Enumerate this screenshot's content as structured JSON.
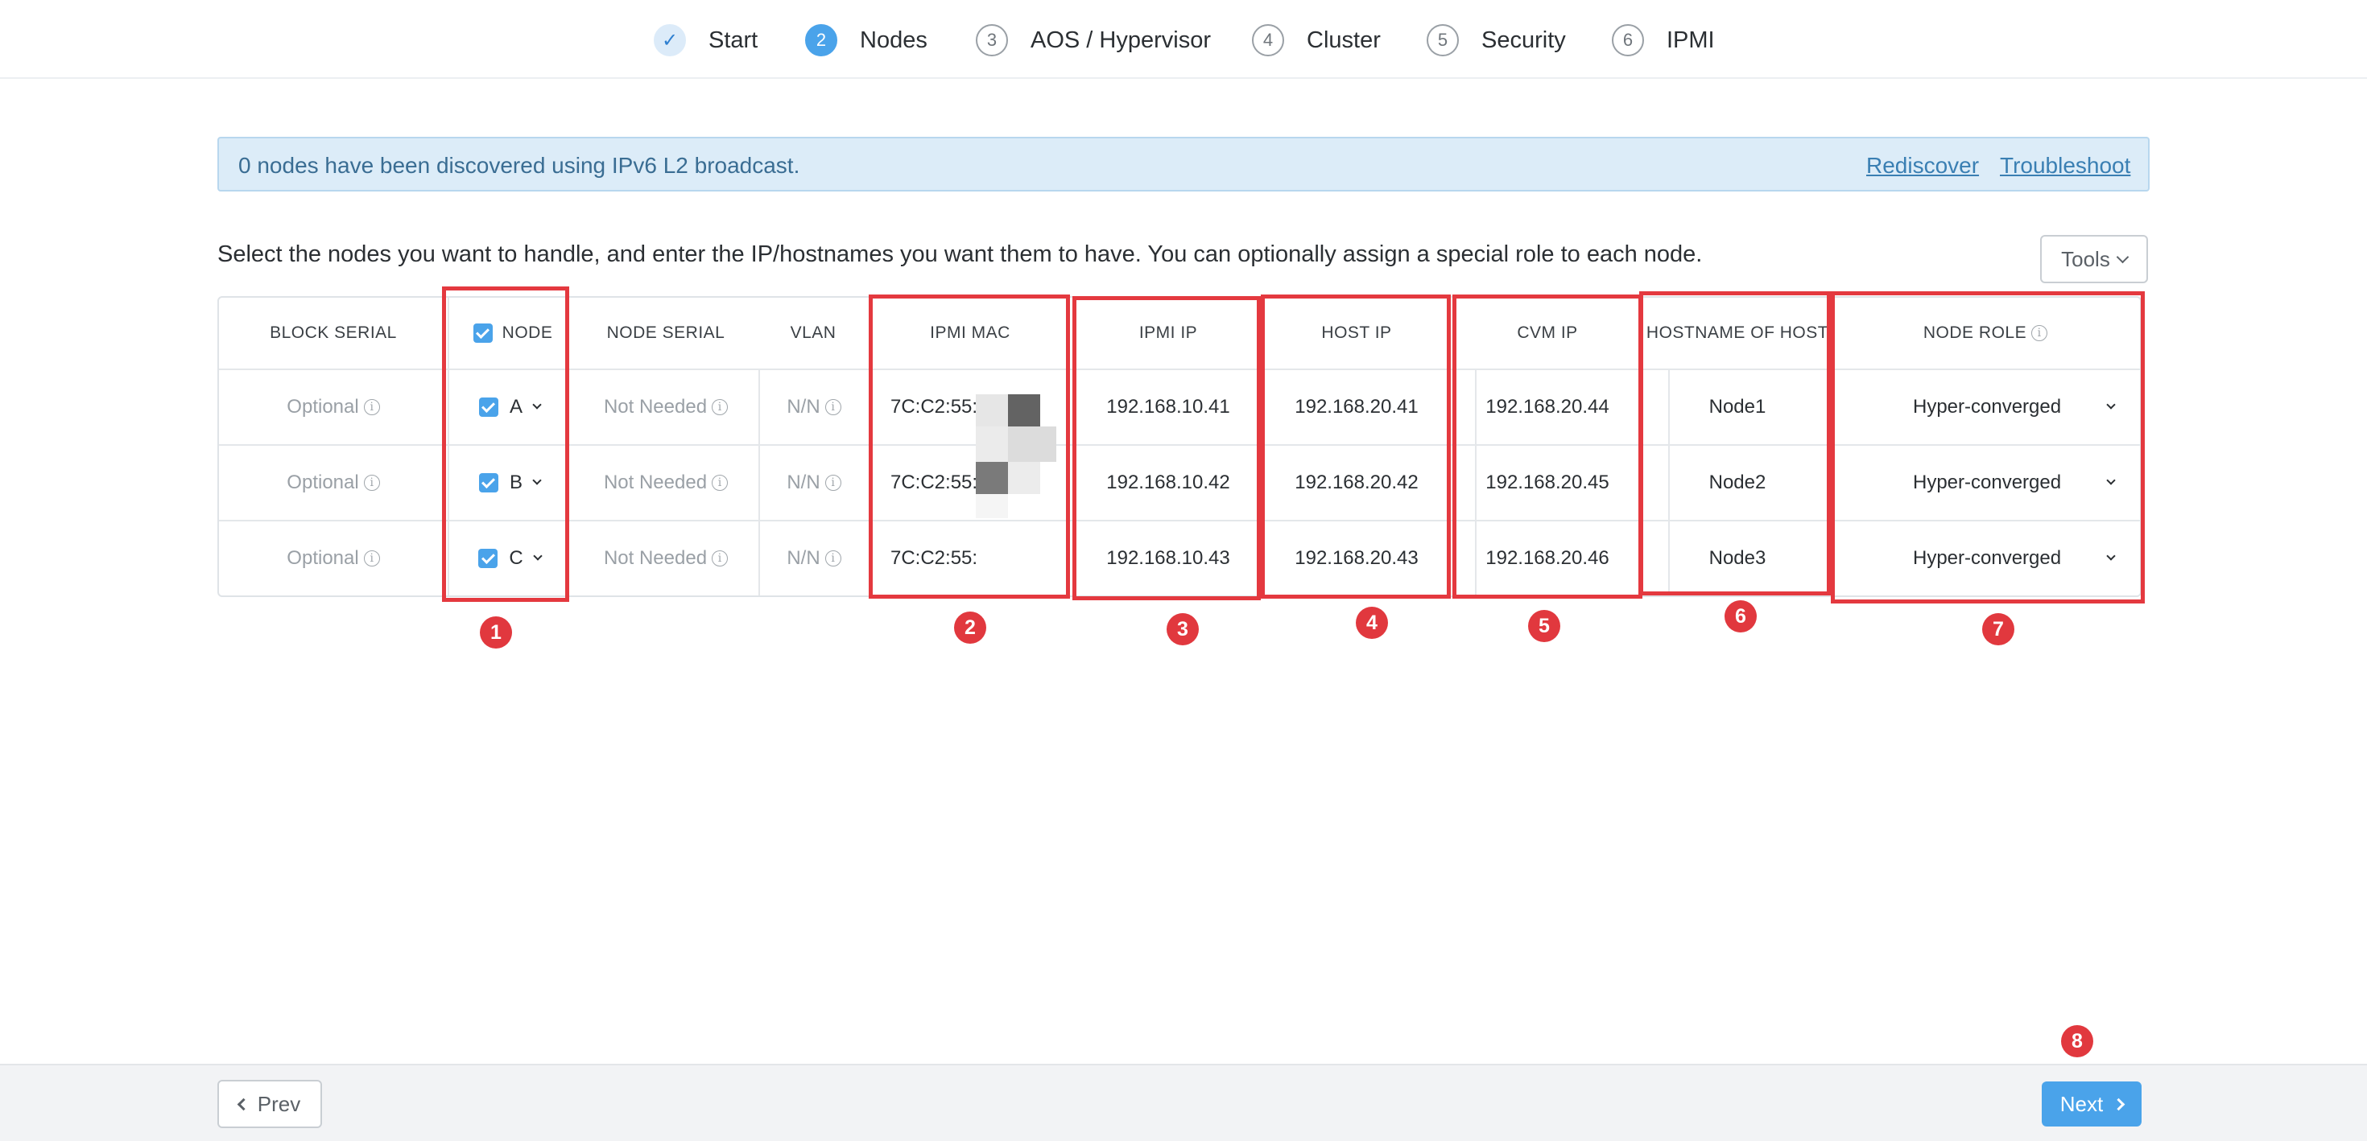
{
  "stepper": {
    "steps": [
      {
        "number": "✓",
        "label": "Start",
        "state": "done"
      },
      {
        "number": "2",
        "label": "Nodes",
        "state": "active"
      },
      {
        "number": "3",
        "label": "AOS / Hypervisor",
        "state": "pending"
      },
      {
        "number": "4",
        "label": "Cluster",
        "state": "pending"
      },
      {
        "number": "5",
        "label": "Security",
        "state": "pending"
      },
      {
        "number": "6",
        "label": "IPMI",
        "state": "pending"
      }
    ]
  },
  "banner": {
    "message": "0 nodes have been discovered using IPv6 L2 broadcast.",
    "rediscover": "Rediscover",
    "troubleshoot": "Troubleshoot"
  },
  "instructions": "Select the nodes you want to handle, and enter the IP/hostnames you want them to have. You can optionally assign a special role to each node.",
  "tools": {
    "label": "Tools"
  },
  "table": {
    "headers": {
      "block_serial": "BLOCK SERIAL",
      "node": "NODE",
      "node_serial": "NODE SERIAL",
      "vlan": "VLAN",
      "ipmi_mac": "IPMI MAC",
      "ipmi_ip": "IPMI IP",
      "host_ip": "HOST IP",
      "cvm_ip": "CVM IP",
      "hostname": "HOSTNAME OF HOST",
      "node_role": "NODE ROLE"
    },
    "rows": [
      {
        "block_serial": "Optional",
        "node": "A",
        "node_serial": "Not Needed",
        "vlan": "N/N",
        "ipmi_mac": "7C:C2:55:",
        "ipmi_ip": "192.168.10.41",
        "host_ip": "192.168.20.41",
        "cvm_ip": "192.168.20.44",
        "hostname": "Node1",
        "node_role": "Hyper-converged"
      },
      {
        "block_serial": "Optional",
        "node": "B",
        "node_serial": "Not Needed",
        "vlan": "N/N",
        "ipmi_mac": "7C:C2:55:",
        "ipmi_ip": "192.168.10.42",
        "host_ip": "192.168.20.42",
        "cvm_ip": "192.168.20.45",
        "hostname": "Node2",
        "node_role": "Hyper-converged"
      },
      {
        "block_serial": "Optional",
        "node": "C",
        "node_serial": "Not Needed",
        "vlan": "N/N",
        "ipmi_mac": "7C:C2:55:",
        "ipmi_ip": "192.168.10.43",
        "host_ip": "192.168.20.43",
        "cvm_ip": "192.168.20.46",
        "hostname": "Node3",
        "node_role": "Hyper-converged"
      }
    ]
  },
  "annotations": [
    "1",
    "2",
    "3",
    "4",
    "5",
    "6",
    "7",
    "8"
  ],
  "footer": {
    "prev": "Prev",
    "next": "Next"
  },
  "colors": {
    "accent": "#4aa3ea",
    "highlight": "#e4393f",
    "banner_bg": "#dcecf8"
  }
}
